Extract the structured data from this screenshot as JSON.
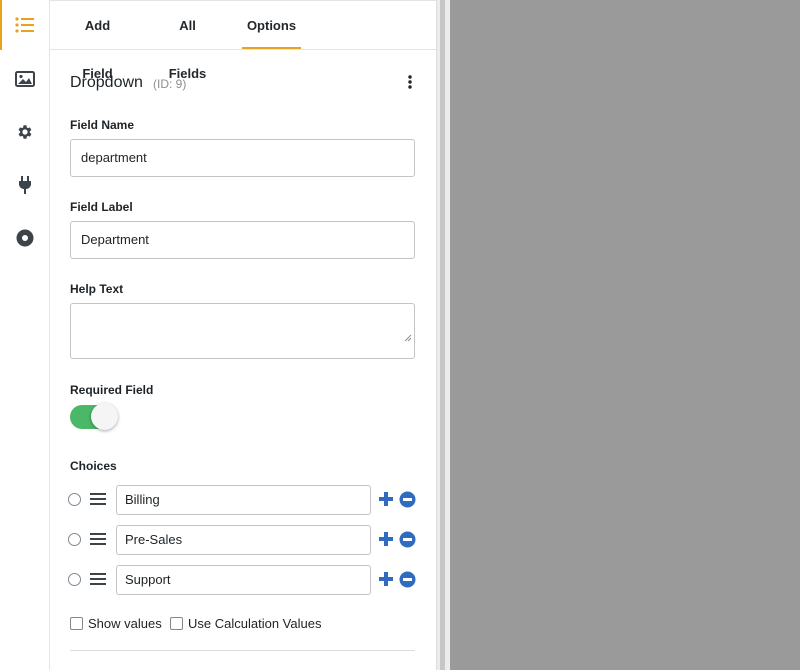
{
  "rail": {
    "items": [
      {
        "icon": "list-icon",
        "active": true
      },
      {
        "icon": "image-icon",
        "active": false
      },
      {
        "icon": "gear-icon",
        "active": false
      },
      {
        "icon": "plug-icon",
        "active": false
      },
      {
        "icon": "record-icon",
        "active": false
      }
    ]
  },
  "tabs": {
    "add_field": "Add Field",
    "all_fields": "All Fields",
    "options": "Options",
    "active": "options"
  },
  "field": {
    "title": "Dropdown",
    "id_label": "(ID: 9)"
  },
  "form": {
    "field_name_label": "Field Name",
    "field_name_value": "department",
    "field_label_label": "Field Label",
    "field_label_value": "Department",
    "help_text_label": "Help Text",
    "help_text_value": "",
    "required_label": "Required Field",
    "required_on": true,
    "choices_label": "Choices",
    "choices": [
      "Billing",
      "Pre-Sales",
      "Support"
    ],
    "show_values_label": "Show values",
    "use_calc_label": "Use Calculation Values"
  },
  "colors": {
    "accent": "#e7a31e",
    "toggle_on": "#4ab866",
    "action_blue": "#2f6bbf",
    "preview_bg": "#9a9a9a"
  }
}
